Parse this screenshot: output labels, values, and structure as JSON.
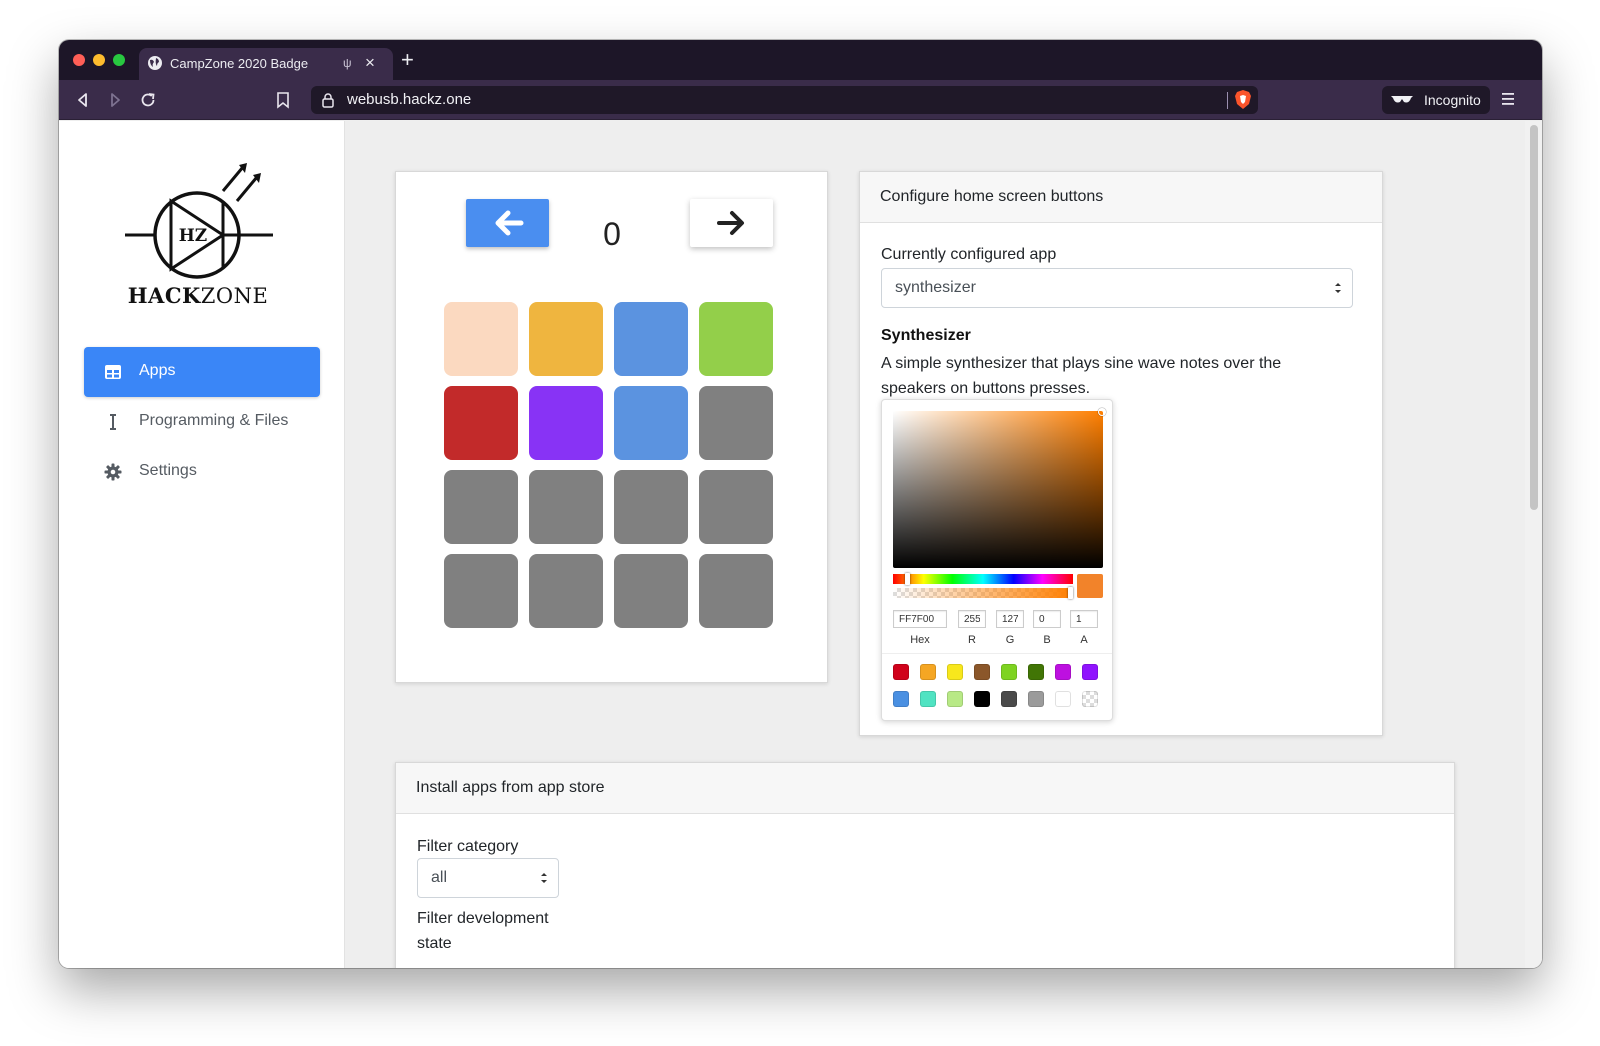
{
  "browser": {
    "tab_title": "CampZone 2020 Badge",
    "new_tab_symbol": "+",
    "tab_close_symbol": "×",
    "url": "webusb.hackz.one",
    "incognito_label": "Incognito"
  },
  "sidebar": {
    "logo_letters": "HZ",
    "logo_text_bold": "HACK",
    "logo_text_regular": "ZONE",
    "items": [
      {
        "label": "Apps",
        "icon": "table-icon",
        "active": true
      },
      {
        "label": "Programming & Files",
        "icon": "cursor-icon",
        "active": false
      },
      {
        "label": "Settings",
        "icon": "gear-icon",
        "active": false
      }
    ]
  },
  "pager": {
    "page_number": "0",
    "grid_colors": [
      "#fbd9c0",
      "#efb53f",
      "#5b93e0",
      "#93cf4a",
      "#c22a2a",
      "#8833f5",
      "#5b93e0",
      "#808080",
      "#808080",
      "#808080",
      "#808080",
      "#808080",
      "#808080",
      "#808080",
      "#808080",
      "#808080"
    ]
  },
  "configure": {
    "header": "Configure home screen buttons",
    "current_label": "Currently configured app",
    "selected_app": "synthesizer",
    "app_name": "Synthesizer",
    "app_description": "A simple synthesizer that plays sine wave notes over the speakers on buttons presses."
  },
  "color_picker": {
    "hex": "FF7F00",
    "r": "255",
    "g": "127",
    "b": "0",
    "a": "1",
    "labels": {
      "hex": "Hex",
      "r": "R",
      "g": "G",
      "b": "B",
      "a": "A"
    },
    "current_color": "#f2832a",
    "hue_level": 0.08,
    "alpha_level": 1.0,
    "presets": [
      "#d0021b",
      "#f5a623",
      "#f8e71c",
      "#8b572a",
      "#7ed321",
      "#417505",
      "#bd10e0",
      "#9013fe",
      "#4a90e2",
      "#50e3c2",
      "#b8e986",
      "#000000",
      "#4a4a4a",
      "#9b9b9b",
      "#ffffff",
      "transparent"
    ]
  },
  "install": {
    "header": "Install apps from app store",
    "filter_category_label": "Filter category",
    "filter_category_value": "all",
    "filter_dev_label": "Filter development state"
  }
}
